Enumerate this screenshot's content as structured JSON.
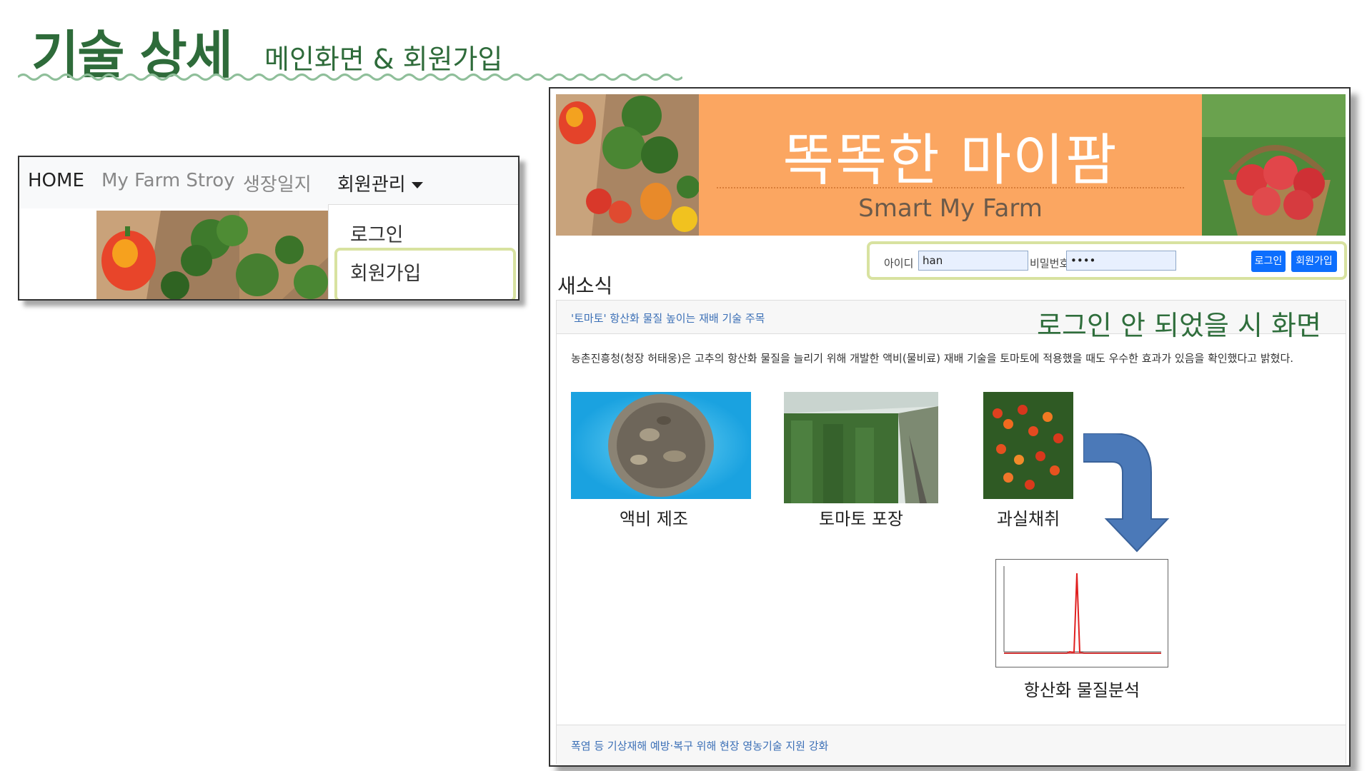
{
  "slide": {
    "title": "기술 상세",
    "subtitle": "메인화면 & 회원가입"
  },
  "navbar": {
    "items": [
      {
        "label": "HOME"
      },
      {
        "label": "My Farm Stroy"
      },
      {
        "label": "생장일지"
      },
      {
        "label": "회원관리"
      }
    ],
    "dropdown": [
      {
        "label": "로그인"
      },
      {
        "label": "회원가입"
      }
    ]
  },
  "banner": {
    "title": "똑똑한 마이팜",
    "subtitle": "Smart My Farm"
  },
  "login": {
    "id_label": "아이디",
    "id_value": "han",
    "pw_label": "비밀번호",
    "pw_value": "••••",
    "login_button": "로그인",
    "signup_button": "회원가입"
  },
  "news": {
    "section_title": "새소식",
    "headline": "'토마토' 항산화 물질 높이는 재배 기술 주목",
    "annotation": "로그인 안 되었을 시 화면",
    "body": "농촌진흥청(청장 허태웅)은 고추의 항산화 물질을 늘리기 위해 개발한 액비(물비료) 재배 기술을 토마토에 적용했을 때도 우수한 효과가 있음을 확인했다고 밝혔다.",
    "captions": [
      "액비 제조",
      "토마토 포장",
      "과실채취",
      "항산화 물질분석"
    ],
    "next_headline": "폭염 등 기상재해 예방·복구 위해 현장 영농기술 지원 강화"
  },
  "colors": {
    "accent_green": "#2e6b3a",
    "banner_orange": "#fba661",
    "button_blue": "#0d6efd",
    "highlight": "#d8e2a0",
    "link_blue": "#3b6fb6",
    "arrow_blue": "#4b79b8"
  }
}
